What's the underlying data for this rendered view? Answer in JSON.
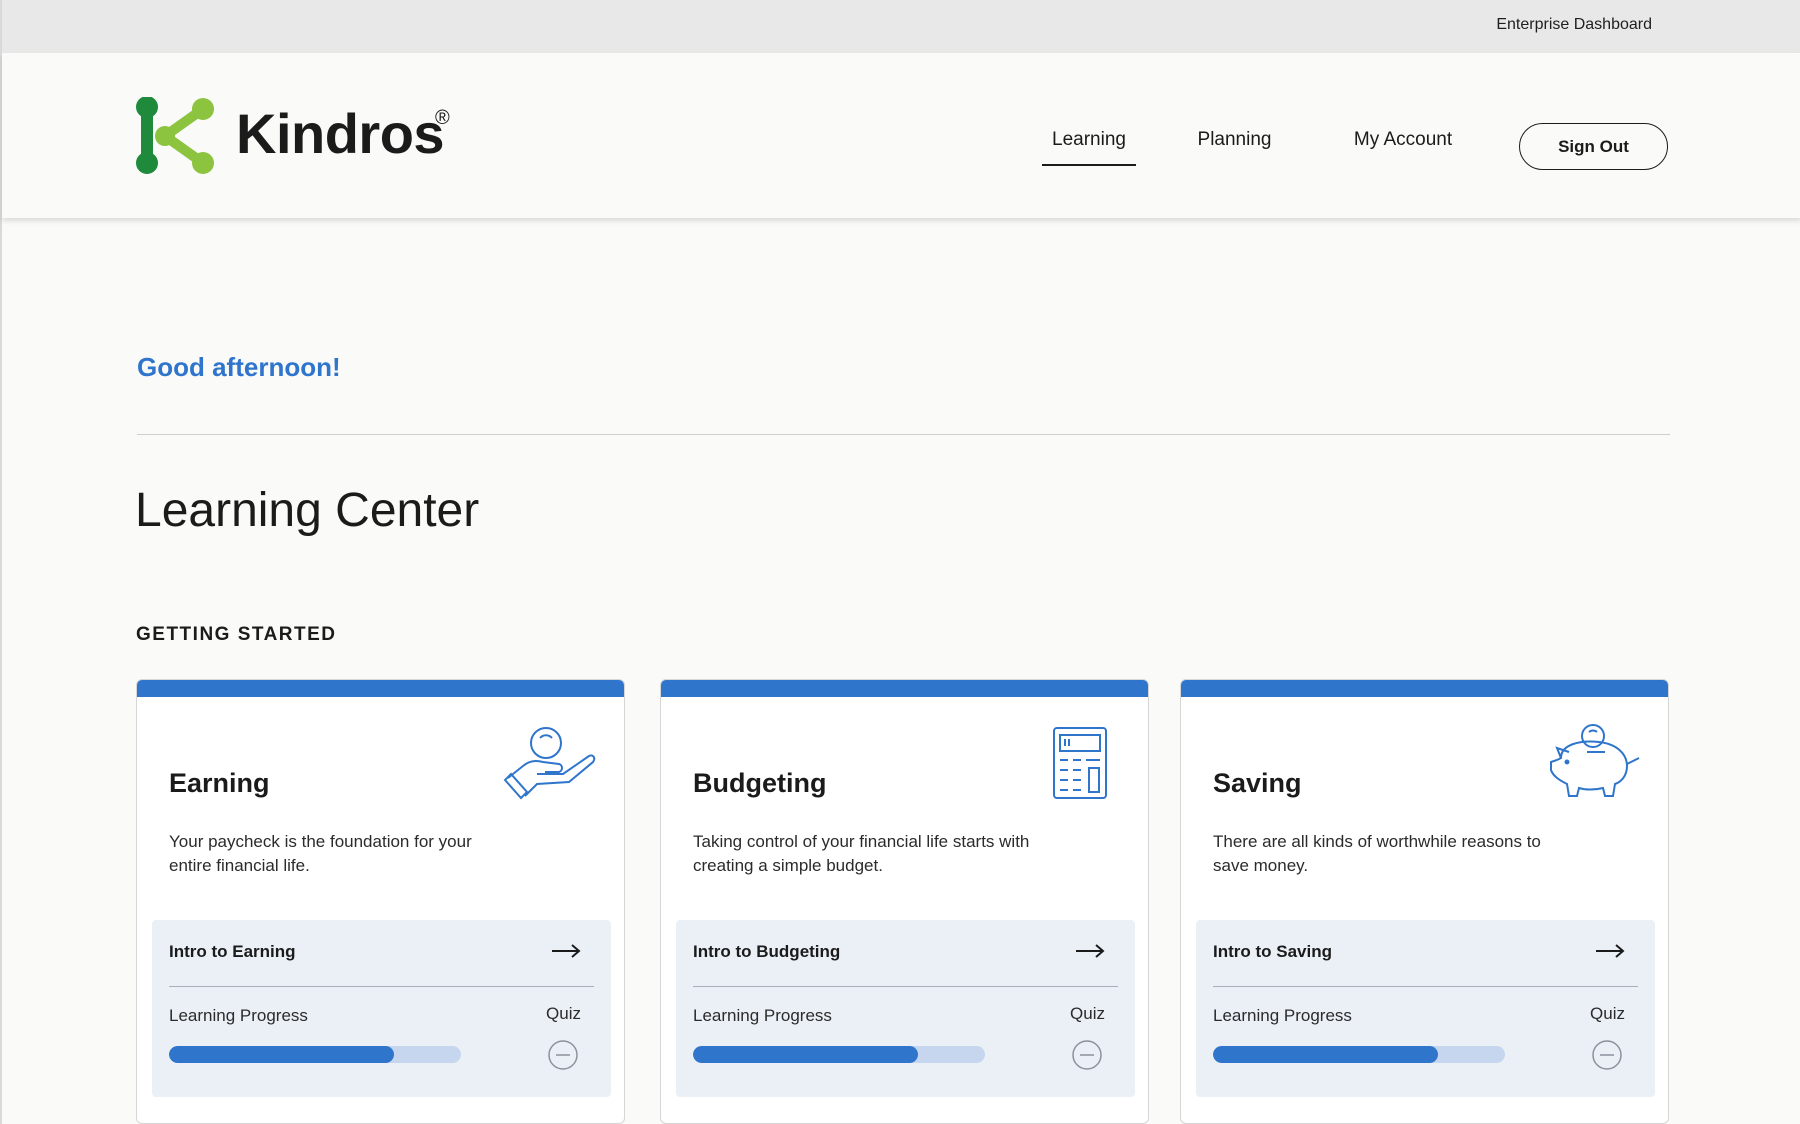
{
  "topbar": {
    "enterprise_label": "Enterprise Dashboard"
  },
  "brand": {
    "name": "Kindros",
    "registered": "®",
    "colors": {
      "dark_green": "#1f8a3b",
      "light_green": "#8cc43f"
    }
  },
  "nav": {
    "items": [
      {
        "label": "Learning",
        "active": true
      },
      {
        "label": "Planning",
        "active": false
      },
      {
        "label": "My Account",
        "active": false
      }
    ],
    "sign_out": "Sign Out"
  },
  "greeting": "Good afternoon!",
  "page_title": "Learning Center",
  "section_label": "GETTING STARTED",
  "accent_color": "#2f75cc",
  "cards": [
    {
      "title": "Earning",
      "description": "Your paycheck is the foundation for your entire financial life.",
      "icon": "hand-coin-icon",
      "lesson": "Intro to Earning",
      "progress_label": "Learning Progress",
      "progress_fraction": 0.77,
      "quiz_label": "Quiz",
      "quiz_status_icon": "minus-circle-icon"
    },
    {
      "title": "Budgeting",
      "description": "Taking control of your financial life starts with creating a simple budget.",
      "icon": "calculator-icon",
      "lesson": "Intro to Budgeting",
      "progress_label": "Learning Progress",
      "progress_fraction": 0.77,
      "quiz_label": "Quiz",
      "quiz_status_icon": "minus-circle-icon"
    },
    {
      "title": "Saving",
      "description": "There are all kinds of worthwhile reasons to save money.",
      "icon": "piggy-bank-icon",
      "lesson": "Intro to Saving",
      "progress_label": "Learning Progress",
      "progress_fraction": 0.77,
      "quiz_label": "Quiz",
      "quiz_status_icon": "minus-circle-icon"
    }
  ]
}
